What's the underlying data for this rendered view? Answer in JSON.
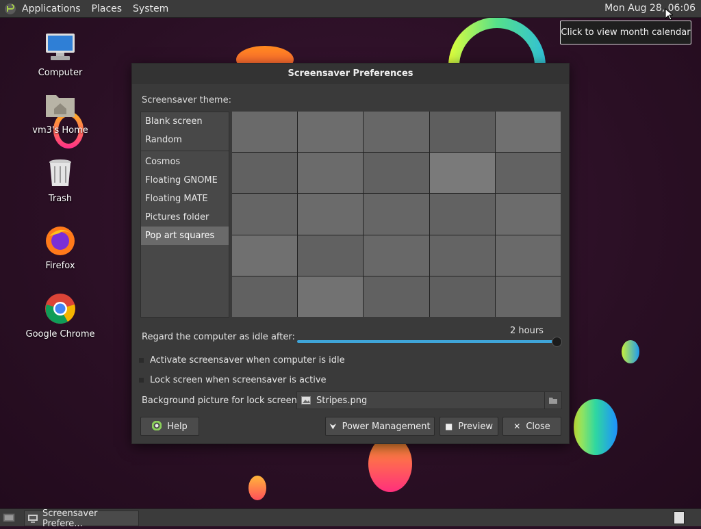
{
  "top_panel": {
    "menus": [
      "Applications",
      "Places",
      "System"
    ],
    "clock": "Mon Aug 28, 06:06",
    "tooltip": "Click to view month calendar"
  },
  "desktop_icons": [
    {
      "label": "Computer",
      "icon": "computer-icon"
    },
    {
      "label": "vm3's Home",
      "icon": "home-folder-icon"
    },
    {
      "label": "Trash",
      "icon": "trash-icon"
    },
    {
      "label": "Firefox",
      "icon": "firefox-icon"
    },
    {
      "label": "Google Chrome",
      "icon": "chrome-icon"
    }
  ],
  "dialog": {
    "title": "Screensaver Preferences",
    "theme_label": "Screensaver theme:",
    "themes_top": [
      "Blank screen",
      "Random"
    ],
    "themes": [
      "Cosmos",
      "Floating GNOME",
      "Floating MATE",
      "Pictures folder",
      "Pop art squares"
    ],
    "selected_theme": "Pop art squares",
    "idle_label": "Regard the computer as idle after:",
    "idle_value": "2 hours",
    "idle_fraction": 1.0,
    "activate_label": "Activate screensaver when computer is idle",
    "activate_checked": false,
    "lock_label": "Lock screen when screensaver is active",
    "lock_checked": false,
    "bg_label": "Background picture for lock screen:",
    "bg_file": "Stripes.png",
    "buttons": {
      "help": "Help",
      "power": "Power Management",
      "preview": "Preview",
      "close": "Close"
    }
  },
  "taskbar": {
    "task_label": "Screensaver Prefere..."
  },
  "colors": {
    "accent": "#3fa5d9",
    "panel": "#3b3b3b",
    "dialog_bg": "#3a3a3a"
  }
}
